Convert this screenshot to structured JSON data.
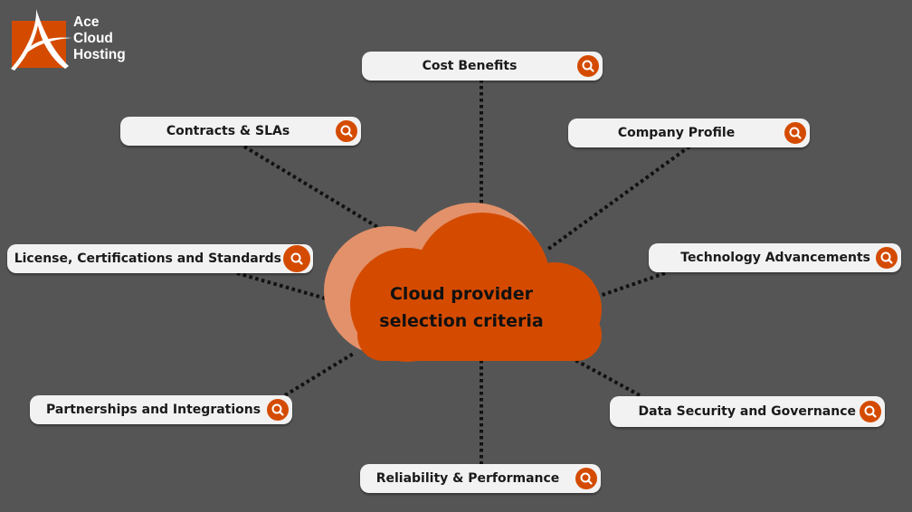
{
  "logo": {
    "line1": "Ace",
    "line2": "Cloud",
    "line3": "Hosting",
    "brand_color": "#d44b00"
  },
  "center": {
    "line1": "Cloud provider",
    "line2": "selection criteria",
    "fill_color": "#d44b00",
    "shadow_color": "#e3916a"
  },
  "criteria": [
    {
      "id": "cost-benefits",
      "label": "Cost Benefits",
      "icon": "search-icon"
    },
    {
      "id": "contracts-slas",
      "label": "Contracts & SLAs",
      "icon": "search-icon"
    },
    {
      "id": "company-profile",
      "label": "Company Profile",
      "icon": "search-icon"
    },
    {
      "id": "license-certifications-standards",
      "label": "License, Certifications and Standards",
      "icon": "search-icon"
    },
    {
      "id": "technology-advancements",
      "label": "Technology Advancements",
      "icon": "search-icon"
    },
    {
      "id": "partnerships-integrations",
      "label": "Partnerships and Integrations",
      "icon": "search-icon"
    },
    {
      "id": "data-security-governance",
      "label": "Data Security and Governance",
      "icon": "search-icon"
    },
    {
      "id": "reliability-performance",
      "label": "Reliability & Performance",
      "icon": "search-icon"
    }
  ],
  "colors": {
    "background": "#555555",
    "pill": "#f2f2f2",
    "icon": "#d44b00",
    "connector": "#111111"
  }
}
